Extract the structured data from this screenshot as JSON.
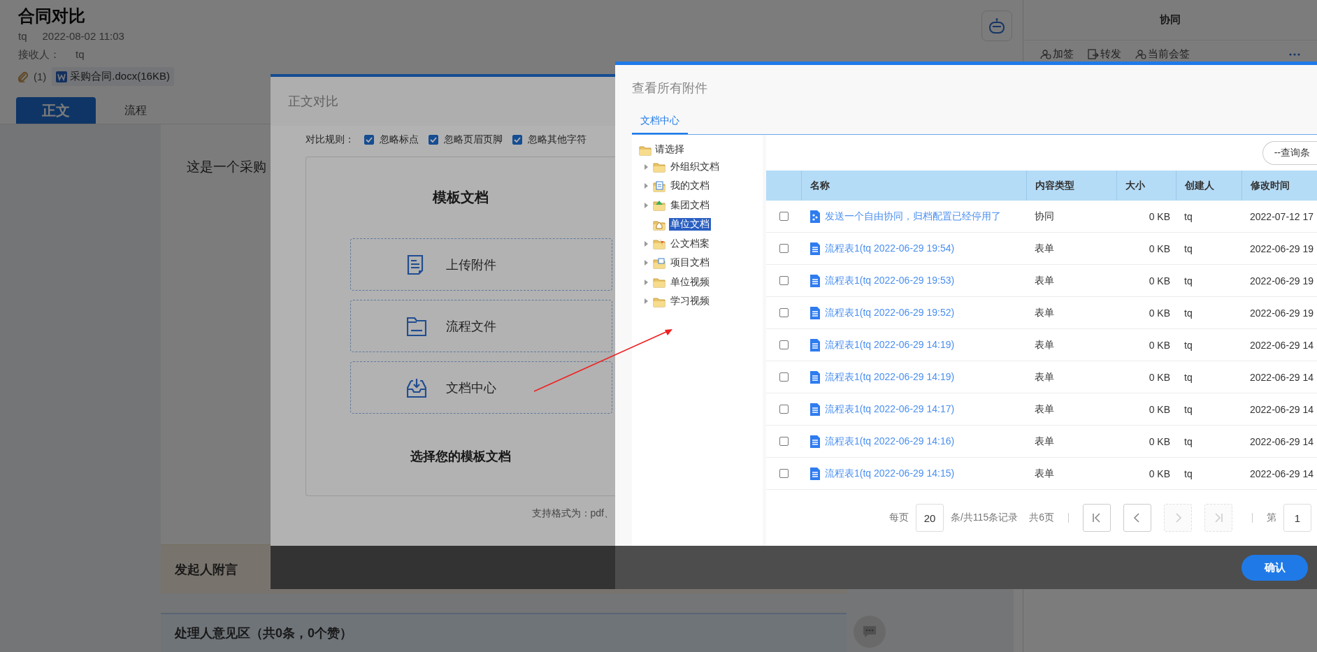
{
  "page": {
    "title": "合同对比",
    "sender": "tq",
    "date": "2022-08-02 11:03",
    "recipient_label": "接收人：",
    "recipient": "tq",
    "attachment_count": "(1)",
    "attachment": "采购合同.docx(16KB)",
    "tabs": [
      {
        "label": "正文",
        "selected": true
      },
      {
        "label": "流程",
        "selected": false
      }
    ],
    "body_text": "这是一个采购",
    "sections": [
      {
        "title": "发起人附言",
        "kind": "note"
      },
      {
        "title": "处理人意见区（共0条，0个赞）",
        "kind": "opinion"
      }
    ]
  },
  "side_panel": {
    "title": "协同",
    "actions": [
      {
        "label": "加签",
        "kind": "add"
      },
      {
        "label": "转发",
        "kind": "forward"
      },
      {
        "label": "当前会签",
        "kind": "cosign"
      }
    ]
  },
  "compare_dialog": {
    "title": "正文对比",
    "rules_label": "对比规则：",
    "rules": [
      {
        "label": "忽略标点",
        "checked": true
      },
      {
        "label": "忽略页眉页脚",
        "checked": true
      },
      {
        "label": "忽略其他字符",
        "checked": true
      }
    ],
    "heading": "模板文档",
    "options": [
      {
        "label": "上传附件",
        "kind": "upload"
      },
      {
        "label": "流程文件",
        "kind": "folder"
      },
      {
        "label": "文档中心",
        "kind": "inbox"
      }
    ],
    "prompt": "选择您的模板文档",
    "formats": "支持格式为：pdf、"
  },
  "attachments_dialog": {
    "title": "查看所有附件",
    "tabs": [
      {
        "label": "文档中心",
        "selected": true
      }
    ],
    "tree": {
      "label": "请选择",
      "children": [
        {
          "label": "外组织文档",
          "kind": "folder",
          "expandable": true,
          "selected": false
        },
        {
          "label": "我的文档",
          "kind": "document",
          "expandable": true,
          "selected": false
        },
        {
          "label": "集团文档",
          "kind": "group",
          "expandable": true,
          "selected": false
        },
        {
          "label": "单位文档",
          "kind": "home",
          "expandable": false,
          "selected": true
        },
        {
          "label": "公文档案",
          "kind": "archive",
          "expandable": true,
          "selected": false
        },
        {
          "label": "项目文档",
          "kind": "project",
          "expandable": true,
          "selected": false
        },
        {
          "label": "单位视频",
          "kind": "folder",
          "expandable": true,
          "selected": false
        },
        {
          "label": "学习视频",
          "kind": "folder",
          "expandable": true,
          "selected": false
        }
      ]
    },
    "query_button": "--查询条",
    "table": {
      "columns": [
        "名称",
        "内容类型",
        "大小",
        "创建人",
        "修改时间"
      ],
      "rows": [
        {
          "checked": false,
          "kind": "cooperation",
          "name": "发送一个自由协同，归档配置已经停用了",
          "type": "协同",
          "size": "0 KB",
          "creator": "tq",
          "modified": "2022-07-12 17"
        },
        {
          "checked": false,
          "kind": "form",
          "name": "流程表1(tq 2022-06-29 19:54)",
          "type": "表单",
          "size": "0 KB",
          "creator": "tq",
          "modified": "2022-06-29 19"
        },
        {
          "checked": false,
          "kind": "form",
          "name": "流程表1(tq 2022-06-29 19:53)",
          "type": "表单",
          "size": "0 KB",
          "creator": "tq",
          "modified": "2022-06-29 19"
        },
        {
          "checked": false,
          "kind": "form",
          "name": "流程表1(tq 2022-06-29 19:52)",
          "type": "表单",
          "size": "0 KB",
          "creator": "tq",
          "modified": "2022-06-29 19"
        },
        {
          "checked": false,
          "kind": "form",
          "name": "流程表1(tq 2022-06-29 14:19)",
          "type": "表单",
          "size": "0 KB",
          "creator": "tq",
          "modified": "2022-06-29 14"
        },
        {
          "checked": false,
          "kind": "form",
          "name": "流程表1(tq 2022-06-29 14:19)",
          "type": "表单",
          "size": "0 KB",
          "creator": "tq",
          "modified": "2022-06-29 14"
        },
        {
          "checked": false,
          "kind": "form",
          "name": "流程表1(tq 2022-06-29 14:17)",
          "type": "表单",
          "size": "0 KB",
          "creator": "tq",
          "modified": "2022-06-29 14"
        },
        {
          "checked": false,
          "kind": "form",
          "name": "流程表1(tq 2022-06-29 14:16)",
          "type": "表单",
          "size": "0 KB",
          "creator": "tq",
          "modified": "2022-06-29 14"
        },
        {
          "checked": false,
          "kind": "form",
          "name": "流程表1(tq 2022-06-29 14:15)",
          "type": "表单",
          "size": "0 KB",
          "creator": "tq",
          "modified": "2022-06-29 14"
        }
      ]
    },
    "pagination": {
      "per_page_label": "每页",
      "per_page": "20",
      "summary": "条/共115条记录",
      "pages": "共6页",
      "page_label": "第",
      "page": "1",
      "nav": [
        {
          "kind": "first",
          "disabled": false
        },
        {
          "kind": "prev",
          "disabled": false
        },
        {
          "kind": "next",
          "disabled": true
        },
        {
          "kind": "last",
          "disabled": true
        }
      ]
    },
    "confirm": "确认"
  },
  "annotations": [
    {
      "kind": "arrow"
    }
  ]
}
